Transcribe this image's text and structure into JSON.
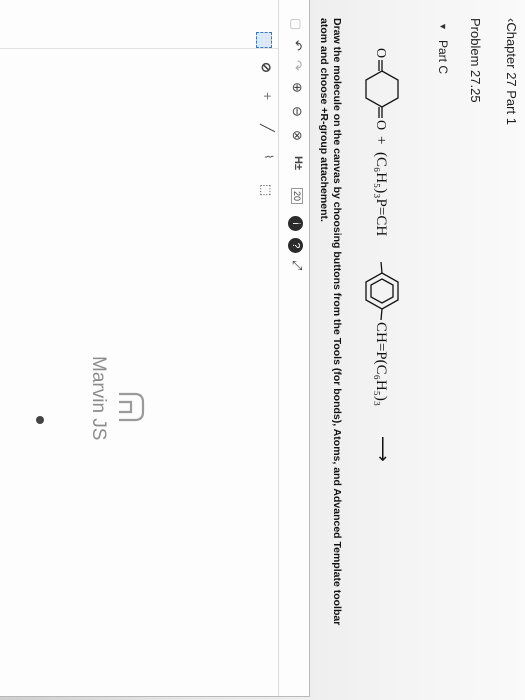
{
  "nav": {
    "chapter_link": "‹Chapter 27 Part 1"
  },
  "problem": {
    "title": "Problem 27.25",
    "part": "Part C"
  },
  "reaction": {
    "plus": "+",
    "ylide1": "(C₆H₅)₃P=CH",
    "ylide2": "CH=P(C₆H₅)₃",
    "arrow": "⟶"
  },
  "instructions": {
    "line1": "Draw the molecule on the canvas by choosing buttons from the Tools (for bonds), Atoms, and Advanced Template toolbar",
    "line2": "atom and choose +R-group attachement."
  },
  "toolbar": {
    "undo": "↶",
    "redo": "↷",
    "zoom_in": "⊕",
    "zoom_out": "⊖",
    "zoom_fit": "⊗",
    "hydrogens": "H±",
    "label_20": "20",
    "info": "i",
    "help": "?",
    "expand": "⤢"
  },
  "left_toolbar": {
    "plus": "+"
  },
  "editor": {
    "brand": "Marvin JS"
  },
  "colors": {
    "background": "#f2f2f2",
    "editor_bg": "#fdfdfd",
    "accent": "#3a78c2"
  }
}
